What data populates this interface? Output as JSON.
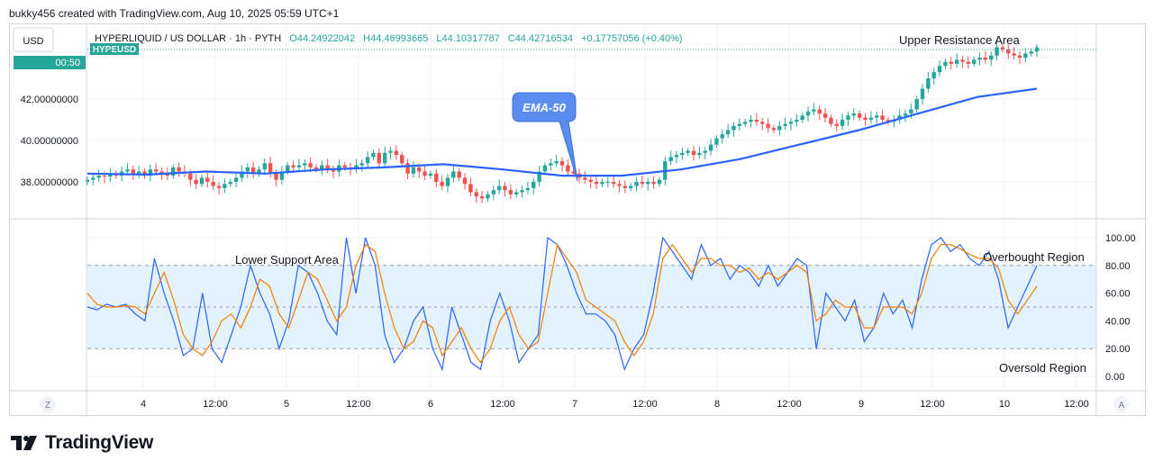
{
  "header": {
    "caption": "bukky456 created with TradingView.com, Aug 10, 2025 05:59 UTC+1"
  },
  "top_left": {
    "currency": "USD",
    "ticker": "HYPEUSD",
    "countdown": "00:50"
  },
  "legend": {
    "symbol": "HYPERLIQUID / US DOLLAR · 1h · PYTH",
    "open": "O44.24922042",
    "high": "H44.46993665",
    "low": "L44.10317787",
    "close": "C44.42716534",
    "change": "+0.17757056 (+0.40%)"
  },
  "annotations": {
    "ema_label": "EMA-50",
    "upper_resistance": "Upper Resistance Area",
    "lower_support": "Lower Support Area",
    "overbought": "Overbought Region",
    "oversold": "Oversold Region"
  },
  "price_axis": [
    "42.00000000",
    "40.00000000",
    "38.00000000"
  ],
  "osc_axis": [
    "100.00",
    "80.00",
    "60.00",
    "40.00",
    "20.00",
    "0.00"
  ],
  "time_axis": [
    "4",
    "12:00",
    "5",
    "12:00",
    "6",
    "12:00",
    "7",
    "12:00",
    "8",
    "12:00",
    "9",
    "12:00",
    "10",
    "12:00"
  ],
  "axis_buttons": {
    "left": "Z",
    "right": "A"
  },
  "brand": "TradingView",
  "colors": {
    "up": "#26a69a",
    "down": "#ef5350",
    "ema": "#2962ff",
    "stoch_k": "#2962ff",
    "stoch_d": "#f57c00",
    "osc_band": "#e3f2fd",
    "callout": "#5b8def"
  },
  "chart_data": [
    {
      "type": "candlestick",
      "x_range": [
        "Aug 3 ~21:00",
        "Aug 10 ~05:00"
      ],
      "ylim": [
        36.2,
        45.7
      ],
      "close_series": [
        38.1,
        38.2,
        38.3,
        38.25,
        38.4,
        38.3,
        38.5,
        38.6,
        38.4,
        38.5,
        38.3,
        38.6,
        38.5,
        38.4,
        38.3,
        38.7,
        38.5,
        38.4,
        38.1,
        37.9,
        38.2,
        38.0,
        37.8,
        37.7,
        37.9,
        38.0,
        38.2,
        38.5,
        38.7,
        38.4,
        38.6,
        38.9,
        38.4,
        38.1,
        38.5,
        38.8,
        38.7,
        38.8,
        38.9,
        38.7,
        38.6,
        38.8,
        38.6,
        38.5,
        38.8,
        38.7,
        38.6,
        38.8,
        38.9,
        39.2,
        39.4,
        38.9,
        39.4,
        39.5,
        39.3,
        38.9,
        38.4,
        38.7,
        38.5,
        38.3,
        38.4,
        38.0,
        37.8,
        38.2,
        38.5,
        38.2,
        37.9,
        37.5,
        37.3,
        37.2,
        37.4,
        37.6,
        37.8,
        37.6,
        37.4,
        37.5,
        37.6,
        37.7,
        38.0,
        38.5,
        38.8,
        38.9,
        39.0,
        38.8,
        38.5,
        38.4,
        38.2,
        38.1,
        38.0,
        37.9,
        38.0,
        38.0,
        37.9,
        37.8,
        37.7,
        37.8,
        38.0,
        37.9,
        38.0,
        37.9,
        38.1,
        39.0,
        39.2,
        39.3,
        39.4,
        39.5,
        39.3,
        39.4,
        39.5,
        39.8,
        40.1,
        40.3,
        40.5,
        40.7,
        40.8,
        40.9,
        41.0,
        40.9,
        40.8,
        40.6,
        40.5,
        40.7,
        40.8,
        40.9,
        41.0,
        41.2,
        41.4,
        41.5,
        41.3,
        41.1,
        40.8,
        40.7,
        41.0,
        41.2,
        41.3,
        41.1,
        41.0,
        41.1,
        41.2,
        41.0,
        40.9,
        41.0,
        41.2,
        41.3,
        41.5,
        42.0,
        42.5,
        43.0,
        43.3,
        43.6,
        43.8,
        43.7,
        43.9,
        43.8,
        43.7,
        43.9,
        44.0,
        43.9,
        44.1,
        44.5,
        44.4,
        44.2,
        44.1,
        44.0,
        44.2,
        44.3,
        44.43
      ],
      "ema50_approx": [
        38.4,
        38.35,
        38.5,
        38.4,
        38.6,
        38.7,
        38.85,
        38.6,
        38.3,
        38.3,
        38.6,
        39.1,
        39.8,
        40.5,
        41.3,
        42.1,
        42.5
      ],
      "current_price": 44.43
    },
    {
      "type": "line",
      "name_hint": "stochastic oscillator",
      "ylim": [
        0,
        100
      ],
      "levels": {
        "overbought": 80,
        "midline": 50,
        "oversold": 20
      },
      "series": [
        {
          "id": "k",
          "values": [
            50,
            48,
            52,
            50,
            52,
            45,
            40,
            85,
            60,
            40,
            15,
            20,
            60,
            20,
            10,
            30,
            50,
            80,
            60,
            45,
            20,
            40,
            80,
            75,
            60,
            40,
            30,
            100,
            60,
            100,
            80,
            30,
            10,
            20,
            40,
            50,
            20,
            5,
            50,
            30,
            10,
            5,
            40,
            60,
            40,
            10,
            20,
            30,
            100,
            95,
            80,
            60,
            45,
            45,
            40,
            30,
            5,
            20,
            30,
            60,
            100,
            90,
            80,
            70,
            95,
            80,
            85,
            70,
            80,
            75,
            65,
            80,
            65,
            75,
            85,
            80,
            20,
            60,
            50,
            40,
            55,
            25,
            35,
            60,
            45,
            55,
            35,
            70,
            95,
            100,
            90,
            95,
            85,
            80,
            90,
            70,
            35,
            50,
            65,
            80
          ]
        },
        {
          "id": "d",
          "values": [
            60,
            52,
            50,
            50,
            51,
            50,
            45,
            60,
            75,
            55,
            30,
            20,
            15,
            25,
            40,
            45,
            35,
            50,
            70,
            65,
            45,
            35,
            55,
            75,
            70,
            55,
            40,
            50,
            80,
            95,
            90,
            60,
            35,
            20,
            25,
            40,
            35,
            15,
            25,
            35,
            20,
            10,
            20,
            40,
            50,
            30,
            20,
            25,
            60,
            95,
            85,
            75,
            55,
            50,
            45,
            40,
            25,
            15,
            25,
            45,
            85,
            95,
            85,
            75,
            85,
            85,
            80,
            80,
            75,
            78,
            70,
            75,
            70,
            75,
            80,
            75,
            40,
            45,
            55,
            50,
            50,
            35,
            35,
            50,
            50,
            50,
            45,
            60,
            85,
            95,
            95,
            92,
            88,
            85,
            85,
            78,
            55,
            45,
            55,
            65
          ]
        }
      ]
    }
  ]
}
